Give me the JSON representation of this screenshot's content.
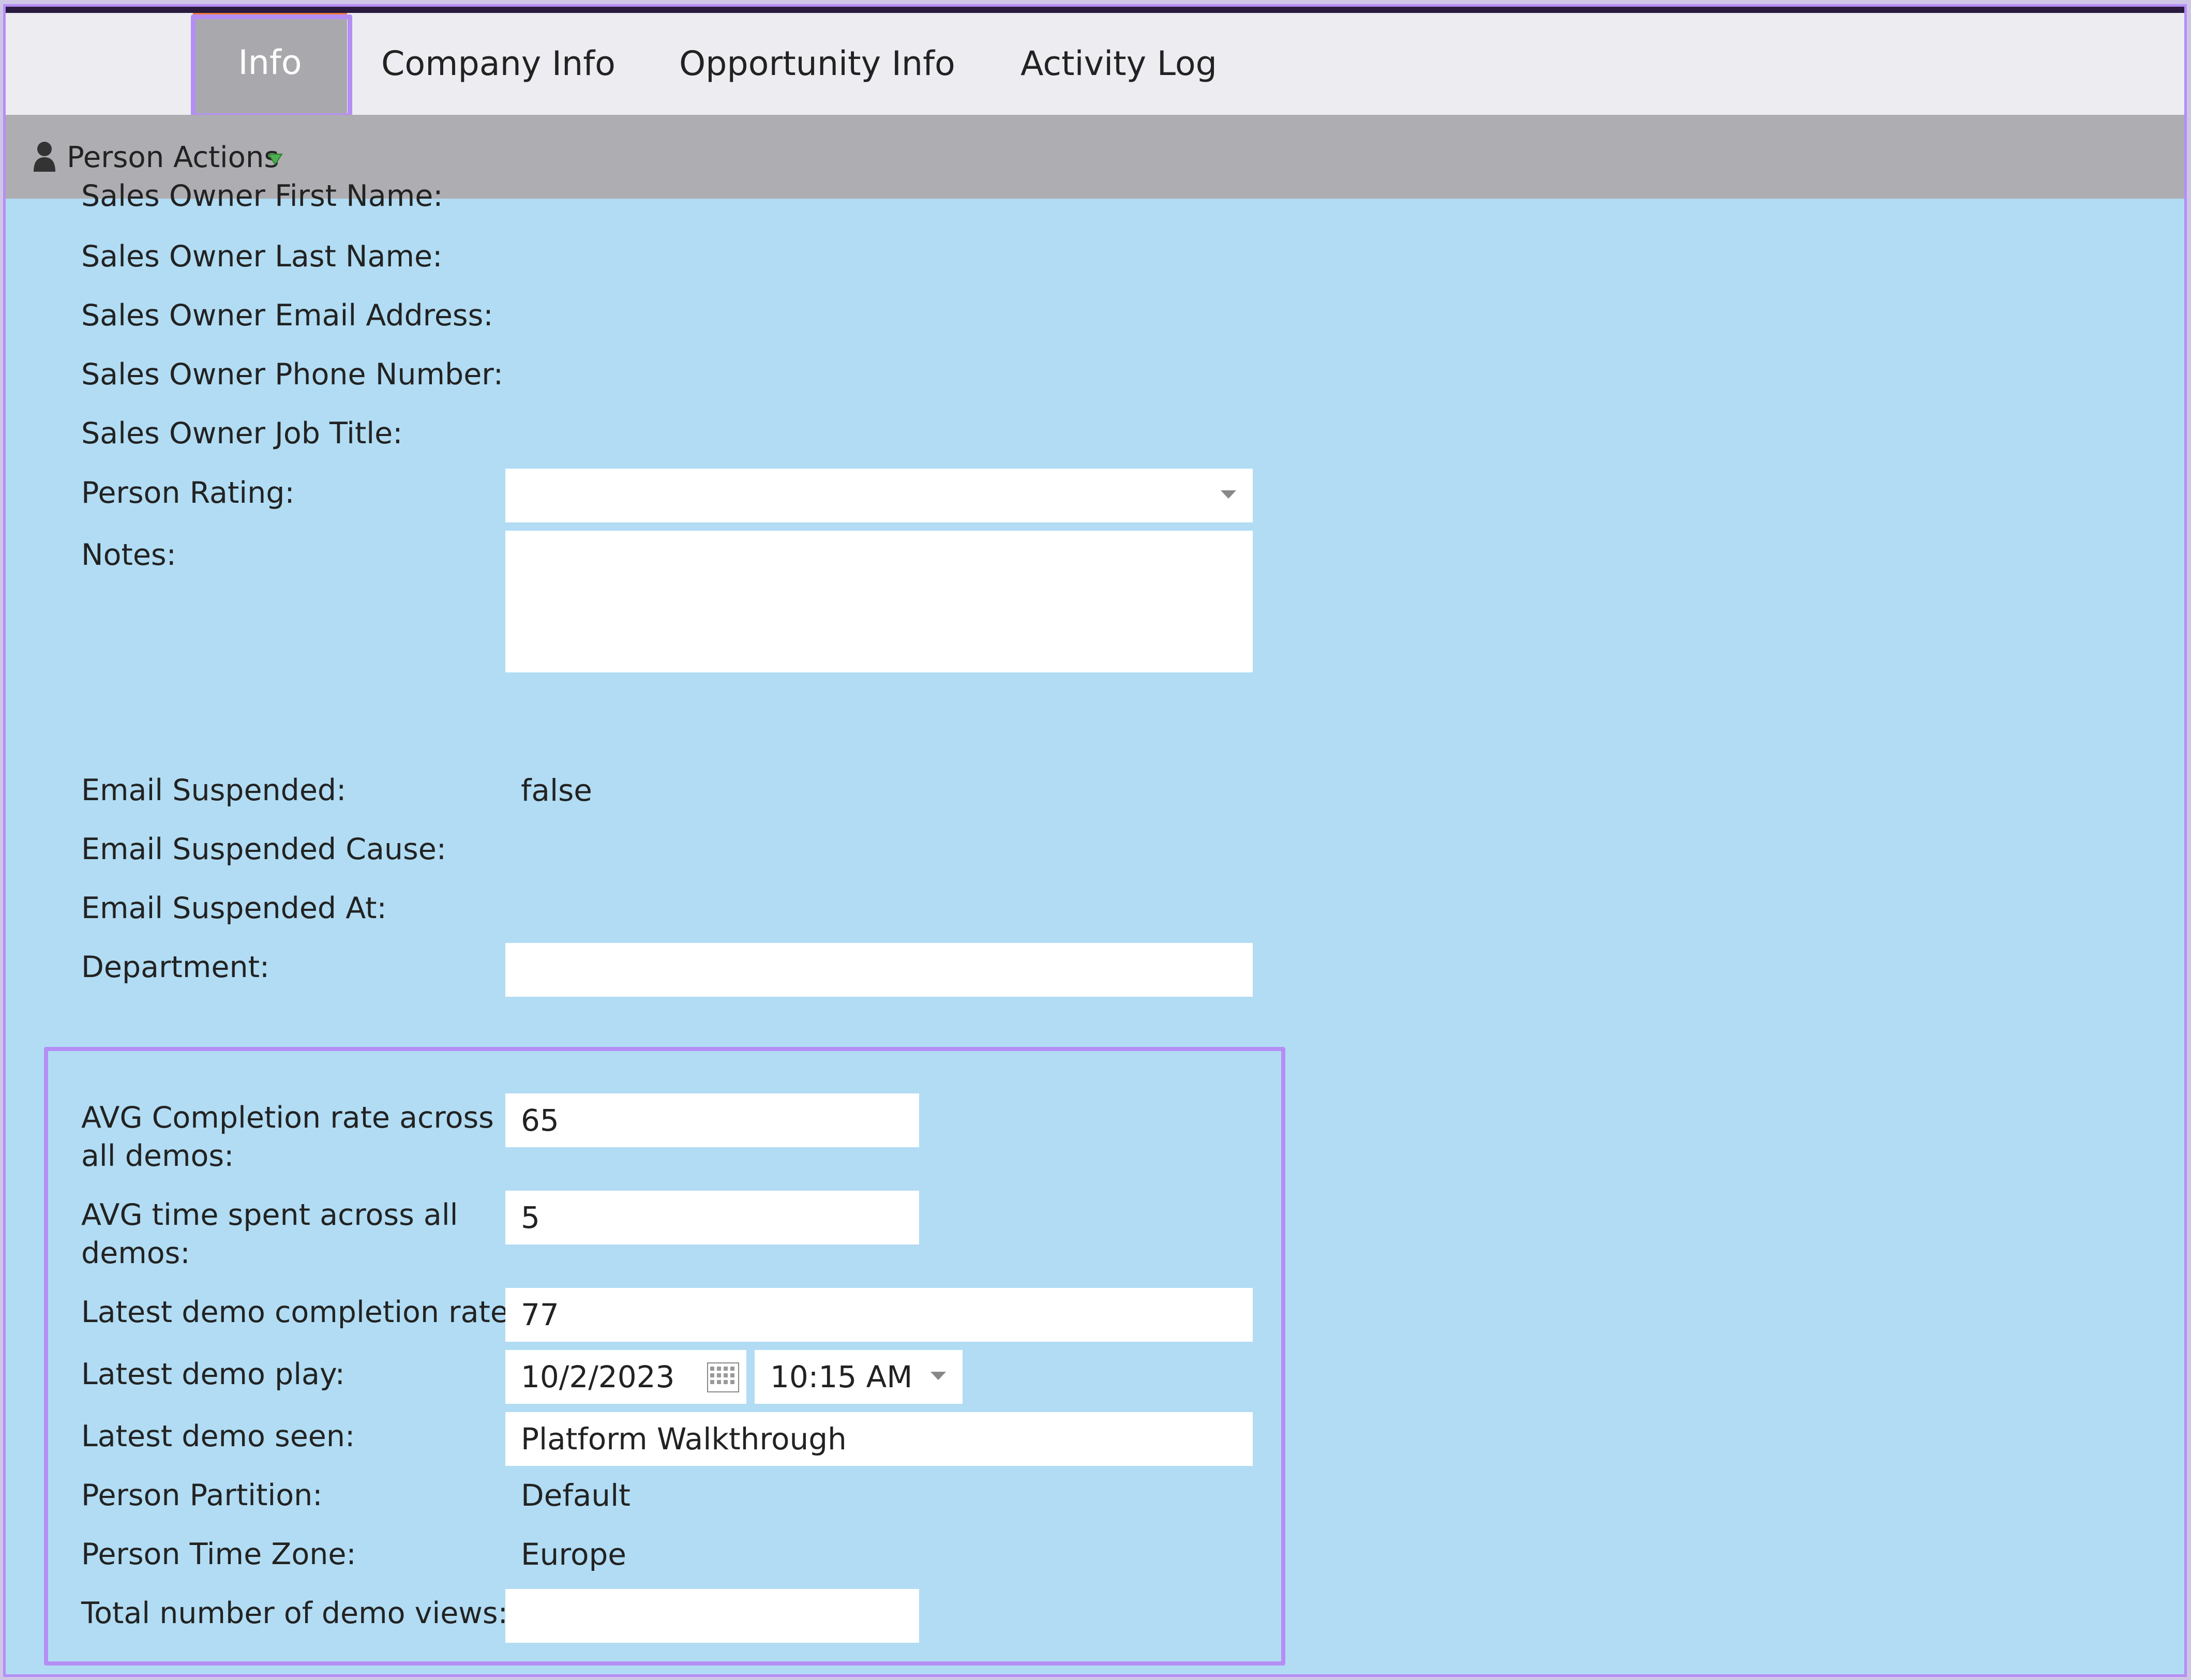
{
  "tabs": [
    {
      "label": "Info",
      "active": true
    },
    {
      "label": "Company Info",
      "active": false
    },
    {
      "label": "Opportunity Info",
      "active": false
    },
    {
      "label": "Activity Log",
      "active": false
    }
  ],
  "actions": {
    "label": "Person Actions"
  },
  "fields": {
    "sales_owner_first_name": {
      "label": "Sales Owner First Name:"
    },
    "sales_owner_last_name": {
      "label": "Sales Owner Last Name:"
    },
    "sales_owner_email": {
      "label": "Sales Owner Email Address:"
    },
    "sales_owner_phone": {
      "label": "Sales Owner Phone Number:"
    },
    "sales_owner_job_title": {
      "label": "Sales Owner Job Title:"
    },
    "person_rating": {
      "label": "Person Rating:",
      "value": ""
    },
    "notes": {
      "label": "Notes:",
      "value": ""
    },
    "email_suspended": {
      "label": "Email Suspended:",
      "value": "false"
    },
    "email_suspended_cause": {
      "label": "Email Suspended Cause:"
    },
    "email_suspended_at": {
      "label": "Email Suspended At:"
    },
    "department": {
      "label": "Department:",
      "value": ""
    }
  },
  "demo_fields": {
    "avg_completion": {
      "label": "AVG Completion rate across all demos:",
      "value": "65"
    },
    "avg_time": {
      "label": "AVG time spent across all demos:",
      "value": "5"
    },
    "latest_completion": {
      "label": "Latest demo completion rate:",
      "value": "77"
    },
    "latest_play": {
      "label": "Latest demo play:",
      "date": "10/2/2023",
      "time": "10:15 AM"
    },
    "latest_seen": {
      "label": "Latest demo seen:",
      "value": "Platform Walkthrough"
    },
    "partition": {
      "label": "Person Partition:",
      "value": "Default"
    },
    "time_zone": {
      "label": "Person Time Zone:",
      "value": "Europe"
    },
    "total_views": {
      "label": "Total number of demo views:",
      "value": ""
    }
  },
  "colors": {
    "content_bg": "#b1dcf3",
    "tab_bar_bg": "#ececf1",
    "action_bar_bg": "#adadb2",
    "active_tab_bg": "#a9a9ad",
    "active_tab_accent": "#ee7a3a",
    "highlight_outline": "#b58ef5",
    "caret_green": "#4caf50"
  }
}
